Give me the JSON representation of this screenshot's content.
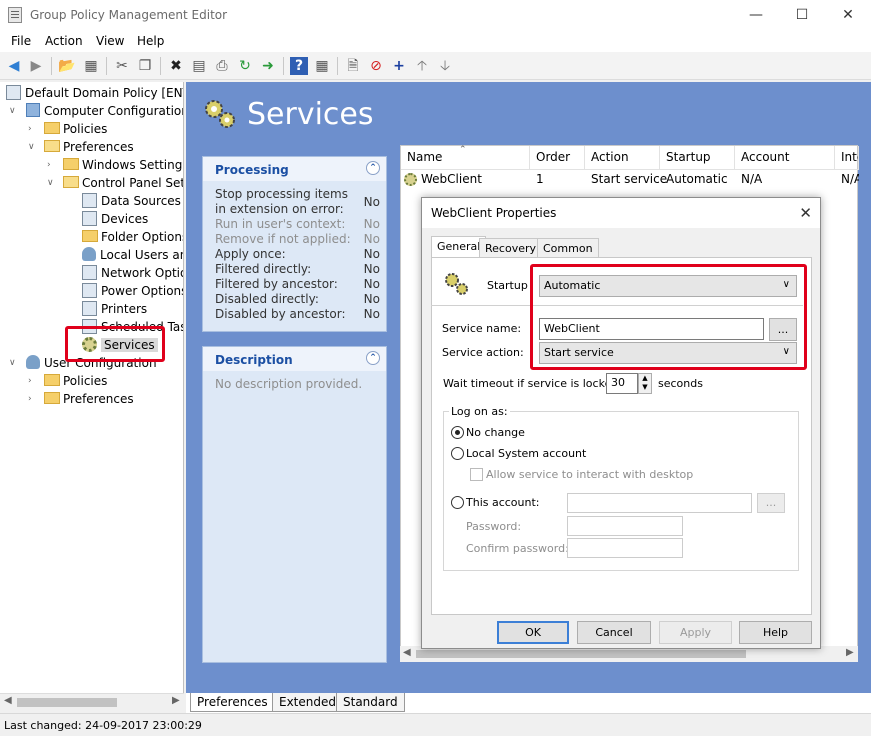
{
  "window": {
    "title": "Group Policy Management Editor"
  },
  "menu": {
    "file": "File",
    "action": "Action",
    "view": "View",
    "help": "Help"
  },
  "tree": {
    "root": "Default Domain Policy [ENTER",
    "computer_config": "Computer Configuration",
    "policies": "Policies",
    "preferences": "Preferences",
    "windows_settings": "Windows Settings",
    "control_panel": "Control Panel Setti",
    "data_sources": "Data Sources",
    "devices": "Devices",
    "folder_options": "Folder Options",
    "local_users": "Local Users and",
    "network_options": "Network Option",
    "power_options": "Power Options",
    "printers": "Printers",
    "scheduled_tasks": "Scheduled Task",
    "services": "Services",
    "user_config": "User Configuration",
    "user_policies": "Policies",
    "user_preferences": "Preferences"
  },
  "main": {
    "heading": "Services",
    "processing": {
      "title": "Processing",
      "rows": [
        {
          "label": "Stop processing items in extension on error:",
          "value": "No",
          "dim": false
        },
        {
          "label": "Run in user's context:",
          "value": "No",
          "dim": true
        },
        {
          "label": "Remove if not applied:",
          "value": "No",
          "dim": true
        },
        {
          "label": "Apply once:",
          "value": "No",
          "dim": false
        },
        {
          "label": "Filtered directly:",
          "value": "No",
          "dim": false
        },
        {
          "label": "Filtered by ancestor:",
          "value": "No",
          "dim": false
        },
        {
          "label": "Disabled directly:",
          "value": "No",
          "dim": false
        },
        {
          "label": "Disabled by ancestor:",
          "value": "No",
          "dim": false
        }
      ]
    },
    "description": {
      "title": "Description",
      "text": "No description provided."
    },
    "list": {
      "columns": [
        "Name",
        "Order",
        "Action",
        "Startup",
        "Account",
        "Inte"
      ],
      "row": {
        "name": "WebClient",
        "order": "1",
        "action": "Start service",
        "startup": "Automatic",
        "account": "N/A",
        "inte": "N/A"
      }
    }
  },
  "dialog": {
    "title": "WebClient Properties",
    "tabs": {
      "general": "General",
      "recovery": "Recovery",
      "common": "Common"
    },
    "startup_label": "Startup",
    "startup_value": "Automatic",
    "service_name_label": "Service name:",
    "service_name_value": "WebClient",
    "browse_label": "...",
    "service_action_label": "Service action:",
    "service_action_value": "Start service",
    "wait_label": "Wait timeout if service is locked:",
    "wait_value": "30",
    "wait_unit": "seconds",
    "logon_label": "Log on as:",
    "no_change": "No change",
    "local_system": "Local System account",
    "allow_interact": "Allow service to interact with desktop",
    "this_account": "This account:",
    "account_browse": "...",
    "password": "Password:",
    "confirm_password": "Confirm password:",
    "buttons": {
      "ok": "OK",
      "cancel": "Cancel",
      "apply": "Apply",
      "help": "Help"
    }
  },
  "bottom_tabs": {
    "preferences": "Preferences",
    "extended": "Extended",
    "standard": "Standard"
  },
  "status": {
    "text": "Last changed: 24-09-2017 23:00:29"
  },
  "colors": {
    "panel_bg": "#6d8fcd",
    "highlight": "#e0001b",
    "accent": "#1b4fa3"
  }
}
